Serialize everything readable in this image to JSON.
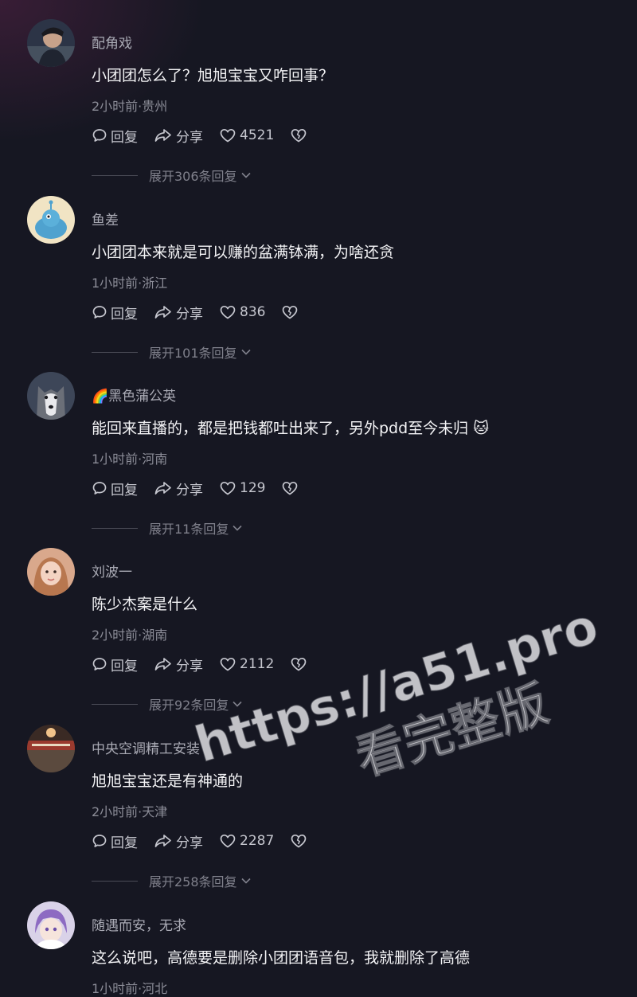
{
  "comments": [
    {
      "username": "配角戏",
      "text": "小团团怎么了？旭旭宝宝又咋回事？",
      "meta": "2小时前·贵州",
      "reply_label": "回复",
      "share_label": "分享",
      "likes": "4521",
      "expand_label": "展开306条回复"
    },
    {
      "username": "鱼差",
      "text": "小团团本来就是可以赚的盆满钵满，为啥还贪",
      "meta": "1小时前·浙江",
      "reply_label": "回复",
      "share_label": "分享",
      "likes": "836",
      "expand_label": "展开101条回复"
    },
    {
      "username": "🌈黑色蒲公英",
      "text": "能回来直播的，都是把钱都吐出来了，另外pdd至今未归 🐱",
      "meta": "1小时前·河南",
      "reply_label": "回复",
      "share_label": "分享",
      "likes": "129",
      "expand_label": "展开11条回复"
    },
    {
      "username": "刘波一",
      "text": "陈少杰案是什么",
      "meta": "2小时前·湖南",
      "reply_label": "回复",
      "share_label": "分享",
      "likes": "2112",
      "expand_label": "展开92条回复"
    },
    {
      "username": "中央空调精工安装",
      "text": "旭旭宝宝还是有神通的",
      "meta": "2小时前·天津",
      "reply_label": "回复",
      "share_label": "分享",
      "likes": "2287",
      "expand_label": "展开258条回复"
    },
    {
      "username": "随遇而安，无求",
      "text": "这么说吧，高德要是删除小团团语音包，我就删除了高德",
      "meta": "1小时前·河北"
    }
  ],
  "watermark": {
    "line1": "https://a51.pro",
    "line2": "看完整版"
  },
  "icons": {
    "reply": "comment-bubble-icon",
    "share": "share-arrow-icon",
    "like": "heart-icon",
    "dislike": "broken-heart-icon",
    "expand": "chevron-down-icon"
  },
  "colors": {
    "background": "#161722",
    "primary_text": "#f4f4f6",
    "secondary_text": "#a9aab4",
    "muted_text": "#8b8c97"
  }
}
